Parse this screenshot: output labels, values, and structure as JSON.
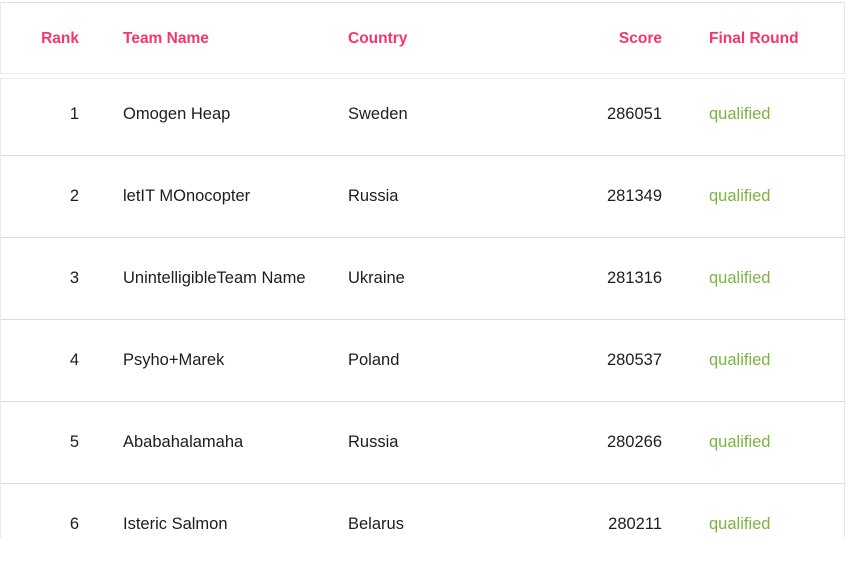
{
  "table": {
    "columns": [
      {
        "key": "rank",
        "label": "Rank",
        "align": "right"
      },
      {
        "key": "team",
        "label": "Team Name",
        "align": "left"
      },
      {
        "key": "country",
        "label": "Country",
        "align": "left"
      },
      {
        "key": "score",
        "label": "Score",
        "align": "right"
      },
      {
        "key": "final",
        "label": "Final Round",
        "align": "left"
      }
    ],
    "header_color": "#f6356e",
    "status_color": "#7cb342",
    "text_color": "#1d1d1f",
    "border_color": "#dcdcdc",
    "rows": [
      {
        "rank": "1",
        "team": "Omogen Heap",
        "country": "Sweden",
        "score": "286051",
        "final": "qualified"
      },
      {
        "rank": "2",
        "team": "letIT MOnocopter",
        "country": "Russia",
        "score": "281349",
        "final": "qualified"
      },
      {
        "rank": "3",
        "team": "UnintelligibleTeam Name",
        "country": "Ukraine",
        "score": "281316",
        "final": "qualified"
      },
      {
        "rank": "4",
        "team": "Psyho+Marek",
        "country": "Poland",
        "score": "280537",
        "final": "qualified"
      },
      {
        "rank": "5",
        "team": "Ababahalamaha",
        "country": "Russia",
        "score": "280266",
        "final": "qualified"
      },
      {
        "rank": "6",
        "team": "Isteric Salmon",
        "country": "Belarus",
        "score": "280211",
        "final": "qualified"
      }
    ]
  }
}
